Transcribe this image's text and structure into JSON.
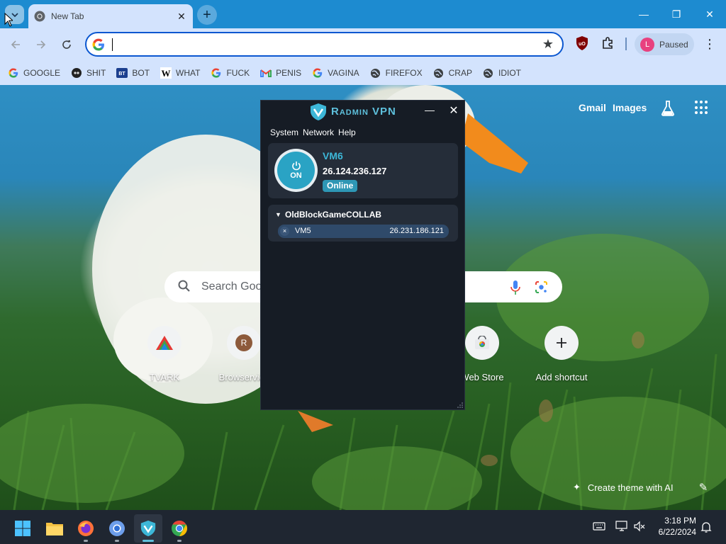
{
  "browser": {
    "tab_title": "New Tab",
    "tab_close": "✕",
    "new_tab": "+",
    "address_value": "",
    "profile_initial": "L",
    "profile_status": "Paused",
    "window_controls": {
      "minimize": "—",
      "maximize": "❐",
      "close": "✕"
    },
    "bookmarks": [
      {
        "label": "GOOGLE",
        "icon": "google-icon"
      },
      {
        "label": "SHIT",
        "icon": "site-icon"
      },
      {
        "label": "BOT",
        "icon": "bt-icon"
      },
      {
        "label": "WHAT",
        "icon": "w-icon"
      },
      {
        "label": "FUCK",
        "icon": "google-icon"
      },
      {
        "label": "PENIS",
        "icon": "gmail-icon"
      },
      {
        "label": "VAGINA",
        "icon": "google-icon"
      },
      {
        "label": "FIREFOX",
        "icon": "globe-icon"
      },
      {
        "label": "CRAP",
        "icon": "globe-icon"
      },
      {
        "label": "IDIOT",
        "icon": "globe-icon"
      }
    ]
  },
  "newtab": {
    "gmail": "Gmail",
    "images": "Images",
    "search_placeholder": "Search Google or type a URL",
    "shortcuts": [
      {
        "label": "TVARK",
        "icon": "tvark-icon"
      },
      {
        "label": "Browservice",
        "initial": "R"
      },
      {
        "label": "Web Store",
        "icon": "webstore-icon"
      },
      {
        "label": "Add shortcut",
        "icon": "plus-icon"
      }
    ],
    "theme_button": "Create theme with AI"
  },
  "radmin": {
    "app_name": "Radmin VPN",
    "menu": [
      "System",
      "Network",
      "Help"
    ],
    "power_label": "ON",
    "hostname": "VM6",
    "ip": "26.124.236.127",
    "status": "Online",
    "network": {
      "name": "OldBlockGameCOLLAB",
      "peers": [
        {
          "name": "VM5",
          "ip": "26.231.186.121"
        }
      ]
    }
  },
  "taskbar": {
    "time": "3:18 PM",
    "date": "6/22/2024",
    "apps": [
      "start-icon",
      "file-explorer-icon",
      "firefox-icon",
      "chromium-icon",
      "radmin-vpn-icon",
      "chrome-icon"
    ]
  },
  "colors": {
    "chrome_tabstrip": "#1d8bd0",
    "chrome_toolbar": "#d3e3fd",
    "radmin_accent": "#3db7d8",
    "taskbar": "#1f2631"
  }
}
